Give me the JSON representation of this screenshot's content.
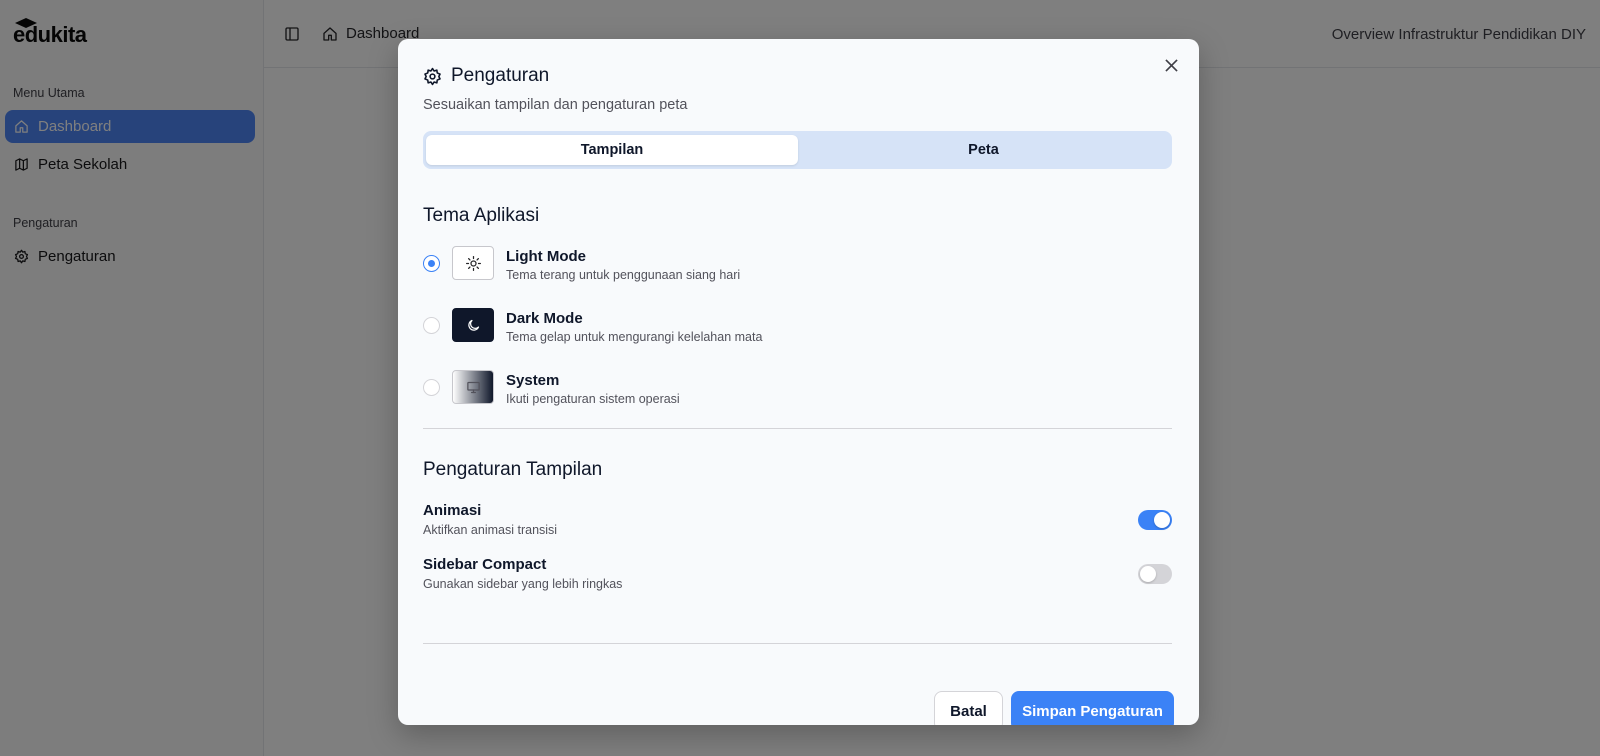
{
  "sidebar": {
    "logo": "edukita",
    "groups": [
      {
        "label": "Menu Utama"
      },
      {
        "label": "Pengaturan"
      }
    ],
    "items": [
      {
        "label": "Dashboard",
        "icon": "home-icon",
        "active": true
      },
      {
        "label": "Peta Sekolah",
        "icon": "map-icon",
        "active": false
      },
      {
        "label": "Pengaturan",
        "icon": "gear-icon",
        "active": false
      }
    ]
  },
  "topbar": {
    "breadcrumb": "Dashboard",
    "right_title": "Overview Infrastruktur Pendidikan DIY"
  },
  "modal": {
    "title": "Pengaturan",
    "subtitle": "Sesuaikan tampilan dan pengaturan peta",
    "tabs": [
      {
        "label": "Tampilan",
        "active": true
      },
      {
        "label": "Peta",
        "active": false
      }
    ],
    "theme_section": {
      "title": "Tema Aplikasi",
      "options": [
        {
          "label": "Light Mode",
          "desc": "Tema terang untuk penggunaan siang hari",
          "icon": "sun-icon",
          "selected": true
        },
        {
          "label": "Dark Mode",
          "desc": "Tema gelap untuk mengurangi kelelahan mata",
          "icon": "moon-icon",
          "selected": false
        },
        {
          "label": "System",
          "desc": "Ikuti pengaturan sistem operasi",
          "icon": "monitor-icon",
          "selected": false
        }
      ]
    },
    "display_section": {
      "title": "Pengaturan Tampilan",
      "settings": [
        {
          "label": "Animasi",
          "desc": "Aktifkan animasi transisi",
          "enabled": true
        },
        {
          "label": "Sidebar Compact",
          "desc": "Gunakan sidebar yang lebih ringkas",
          "enabled": false
        }
      ]
    },
    "buttons": {
      "cancel": "Batal",
      "save": "Simpan Pengaturan"
    }
  },
  "colors": {
    "accent": "#3b82f6",
    "active_sidebar": "#4f86f7",
    "tab_track": "#d6e3f7",
    "logo_accent": "#eab308"
  }
}
